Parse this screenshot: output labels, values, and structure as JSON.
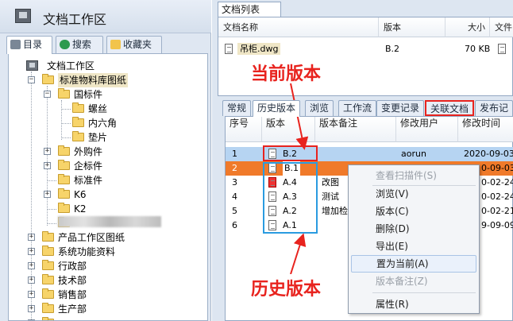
{
  "workspace": {
    "title": "文档工作区",
    "tabs": [
      "目录",
      "搜索",
      "收藏夹"
    ]
  },
  "tree": {
    "root": "文档工作区",
    "nodes": [
      {
        "label": "标准物料库图纸",
        "selected": true
      },
      {
        "label": "国标件"
      },
      {
        "label": "螺丝"
      },
      {
        "label": "内六角"
      },
      {
        "label": "垫片"
      },
      {
        "label": "外购件"
      },
      {
        "label": "企标件"
      },
      {
        "label": "标准件"
      },
      {
        "label": "K6"
      },
      {
        "label": "K2"
      },
      {
        "label": "产品工作区图纸"
      },
      {
        "label": "系统功能资料"
      },
      {
        "label": "行政部"
      },
      {
        "label": "技术部"
      },
      {
        "label": "销售部"
      },
      {
        "label": "生产部"
      }
    ]
  },
  "doclist": {
    "tab": "文档列表",
    "columns": [
      "文档名称",
      "版本",
      "大小",
      "文件"
    ],
    "rows": [
      {
        "name": "吊柜.dwg",
        "version": "B.2",
        "size": "70 KB"
      }
    ]
  },
  "annotations": {
    "current": "当前版本",
    "history": "历史版本"
  },
  "detail_tabs": [
    "常规",
    "历史版本",
    "浏览",
    "工作流",
    "变更记录",
    "关联文档",
    "发布记录"
  ],
  "history": {
    "columns": [
      "序号",
      "版本",
      "版本备注",
      "修改用户",
      "修改时间"
    ],
    "rows": [
      {
        "no": "1",
        "version": "B.2",
        "note": "",
        "user": "aorun",
        "time": "2020-09-03"
      },
      {
        "no": "2",
        "version": "B.1",
        "note": "",
        "user": "",
        "time": "0-09-03"
      },
      {
        "no": "3",
        "version": "A.4",
        "note": "改图",
        "user": "",
        "time": "0-02-24"
      },
      {
        "no": "4",
        "version": "A.3",
        "note": "测试",
        "user": "",
        "time": "0-02-24"
      },
      {
        "no": "5",
        "version": "A.2",
        "note": "增加检",
        "user": "",
        "time": "0-02-21"
      },
      {
        "no": "6",
        "version": "A.1",
        "note": "",
        "user": "",
        "time": "9-09-09"
      }
    ]
  },
  "context_menu": [
    {
      "label": "查看扫描件(S)",
      "disabled": true
    },
    {
      "label": "浏览(V)"
    },
    {
      "label": "版本(C)"
    },
    {
      "label": "删除(D)"
    },
    {
      "label": "导出(E)"
    },
    {
      "label": "置为当前(A)",
      "hover": true
    },
    {
      "label": "版本备注(Z)",
      "disabled": true
    },
    {
      "label": "属性(R)"
    }
  ],
  "colors": {
    "selected_row": "#f07a2a",
    "highlight_row": "#b6d4f2",
    "annotation_red": "#e8231e",
    "annotation_blue": "#2a9be0"
  }
}
